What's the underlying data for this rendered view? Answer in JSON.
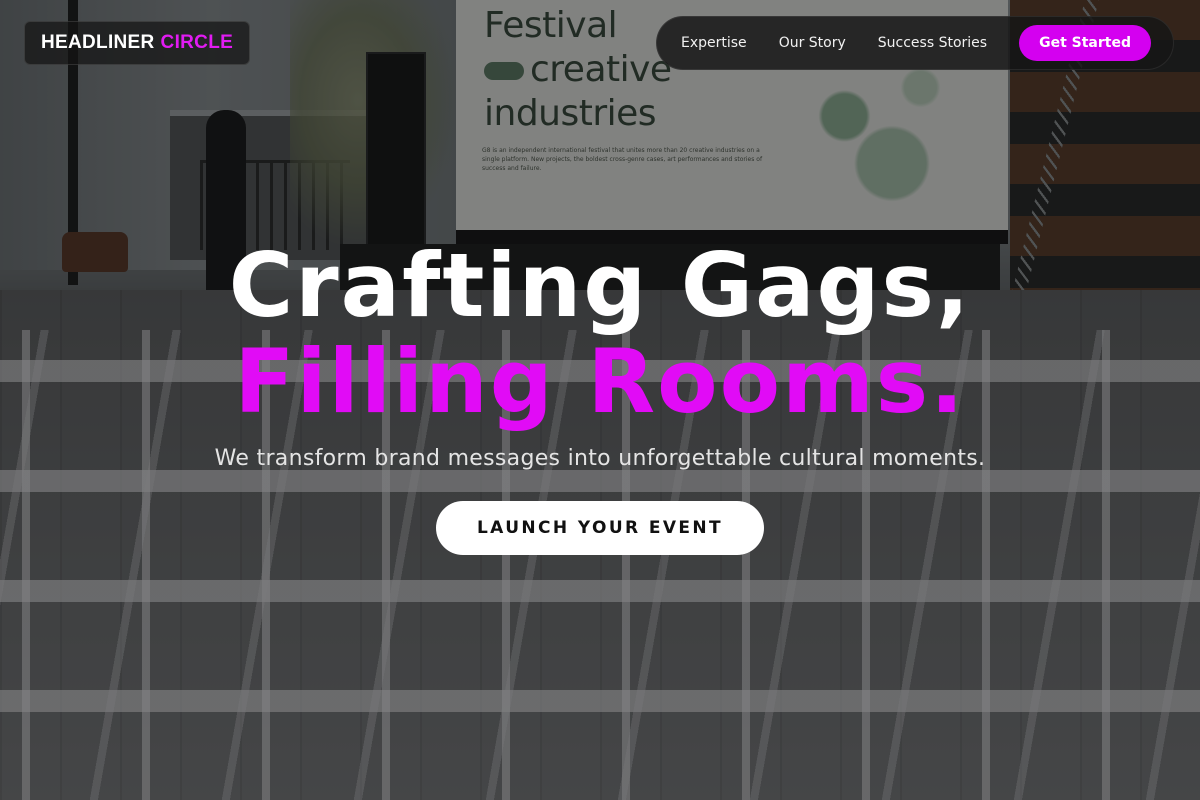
{
  "brand": {
    "name_main": "HEADLINER",
    "name_accent": "CIRCLE",
    "accent_color": "#e11bf2"
  },
  "nav": {
    "links": [
      {
        "label": "Expertise"
      },
      {
        "label": "Our Story"
      },
      {
        "label": "Success Stories"
      }
    ],
    "cta_label": "Get Started",
    "cta_color": "#d400f0"
  },
  "hero": {
    "headline_line1": "Crafting Gags,",
    "headline_line2": "Filling Rooms.",
    "subtitle": "We transform brand messages into unforgettable cultural moments.",
    "cta_label": "LAUNCH YOUR EVENT"
  },
  "background": {
    "screen_title_line1": "Festival",
    "screen_title_line2": "creative",
    "screen_title_line3": "industries",
    "screen_text": "G8 is an independent international festival that unites more than 20 creative industries on a single platform. New projects, the boldest cross-genre cases, art performances and stories of success and failure."
  }
}
